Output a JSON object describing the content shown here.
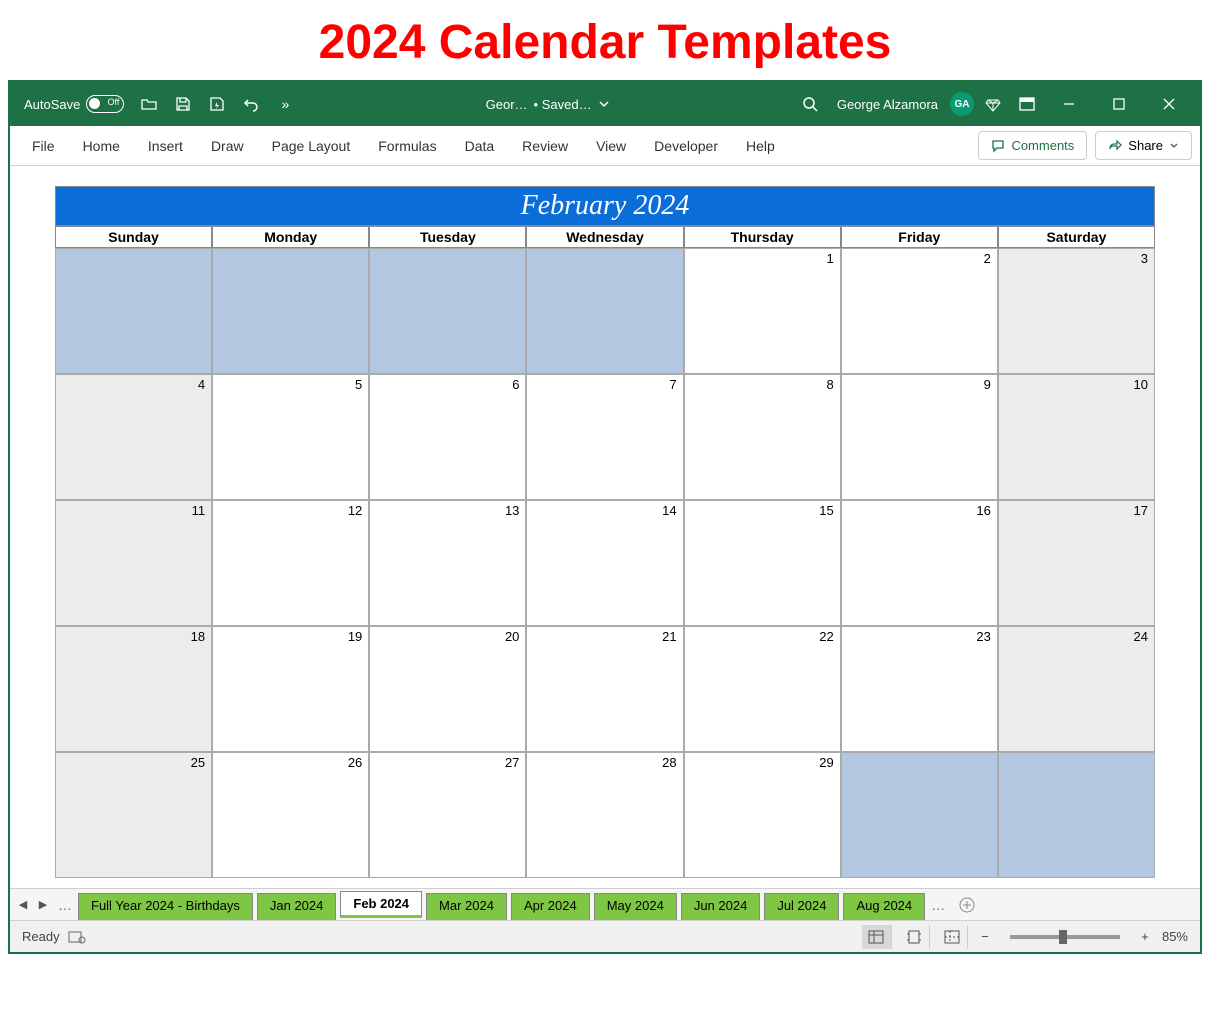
{
  "page_title": "2024 Calendar Templates",
  "titlebar": {
    "autosave_label": "AutoSave",
    "doc_name": "Geor…",
    "save_status": "• Saved…",
    "user_name": "George Alzamora",
    "user_initials": "GA"
  },
  "ribbon": {
    "tabs": [
      "File",
      "Home",
      "Insert",
      "Draw",
      "Page Layout",
      "Formulas",
      "Data",
      "Review",
      "View",
      "Developer",
      "Help"
    ],
    "comments_label": "Comments",
    "share_label": "Share"
  },
  "calendar": {
    "title": "February 2024",
    "days": [
      "Sunday",
      "Monday",
      "Tuesday",
      "Wednesday",
      "Thursday",
      "Friday",
      "Saturday"
    ],
    "cells": [
      {
        "n": "",
        "cls": "prev"
      },
      {
        "n": "",
        "cls": "prev"
      },
      {
        "n": "",
        "cls": "prev"
      },
      {
        "n": "",
        "cls": "prev"
      },
      {
        "n": "1",
        "cls": "weekday"
      },
      {
        "n": "2",
        "cls": "weekday"
      },
      {
        "n": "3",
        "cls": "weekend"
      },
      {
        "n": "4",
        "cls": "weekend"
      },
      {
        "n": "5",
        "cls": "weekday"
      },
      {
        "n": "6",
        "cls": "weekday"
      },
      {
        "n": "7",
        "cls": "weekday"
      },
      {
        "n": "8",
        "cls": "weekday"
      },
      {
        "n": "9",
        "cls": "weekday"
      },
      {
        "n": "10",
        "cls": "weekend"
      },
      {
        "n": "11",
        "cls": "weekend"
      },
      {
        "n": "12",
        "cls": "weekday"
      },
      {
        "n": "13",
        "cls": "weekday"
      },
      {
        "n": "14",
        "cls": "weekday"
      },
      {
        "n": "15",
        "cls": "weekday"
      },
      {
        "n": "16",
        "cls": "weekday"
      },
      {
        "n": "17",
        "cls": "weekend"
      },
      {
        "n": "18",
        "cls": "weekend"
      },
      {
        "n": "19",
        "cls": "weekday"
      },
      {
        "n": "20",
        "cls": "weekday"
      },
      {
        "n": "21",
        "cls": "weekday"
      },
      {
        "n": "22",
        "cls": "weekday"
      },
      {
        "n": "23",
        "cls": "weekday"
      },
      {
        "n": "24",
        "cls": "weekend"
      },
      {
        "n": "25",
        "cls": "weekend"
      },
      {
        "n": "26",
        "cls": "weekday"
      },
      {
        "n": "27",
        "cls": "weekday"
      },
      {
        "n": "28",
        "cls": "weekday"
      },
      {
        "n": "29",
        "cls": "weekday"
      },
      {
        "n": "",
        "cls": "next"
      },
      {
        "n": "",
        "cls": "next"
      }
    ]
  },
  "sheets": {
    "tabs": [
      "Full Year 2024 - Birthdays",
      "Jan 2024",
      "Feb 2024",
      "Mar 2024",
      "Apr 2024",
      "May 2024",
      "Jun 2024",
      "Jul 2024",
      "Aug 2024"
    ],
    "active": "Feb 2024"
  },
  "status": {
    "ready": "Ready",
    "zoom": "85%"
  }
}
